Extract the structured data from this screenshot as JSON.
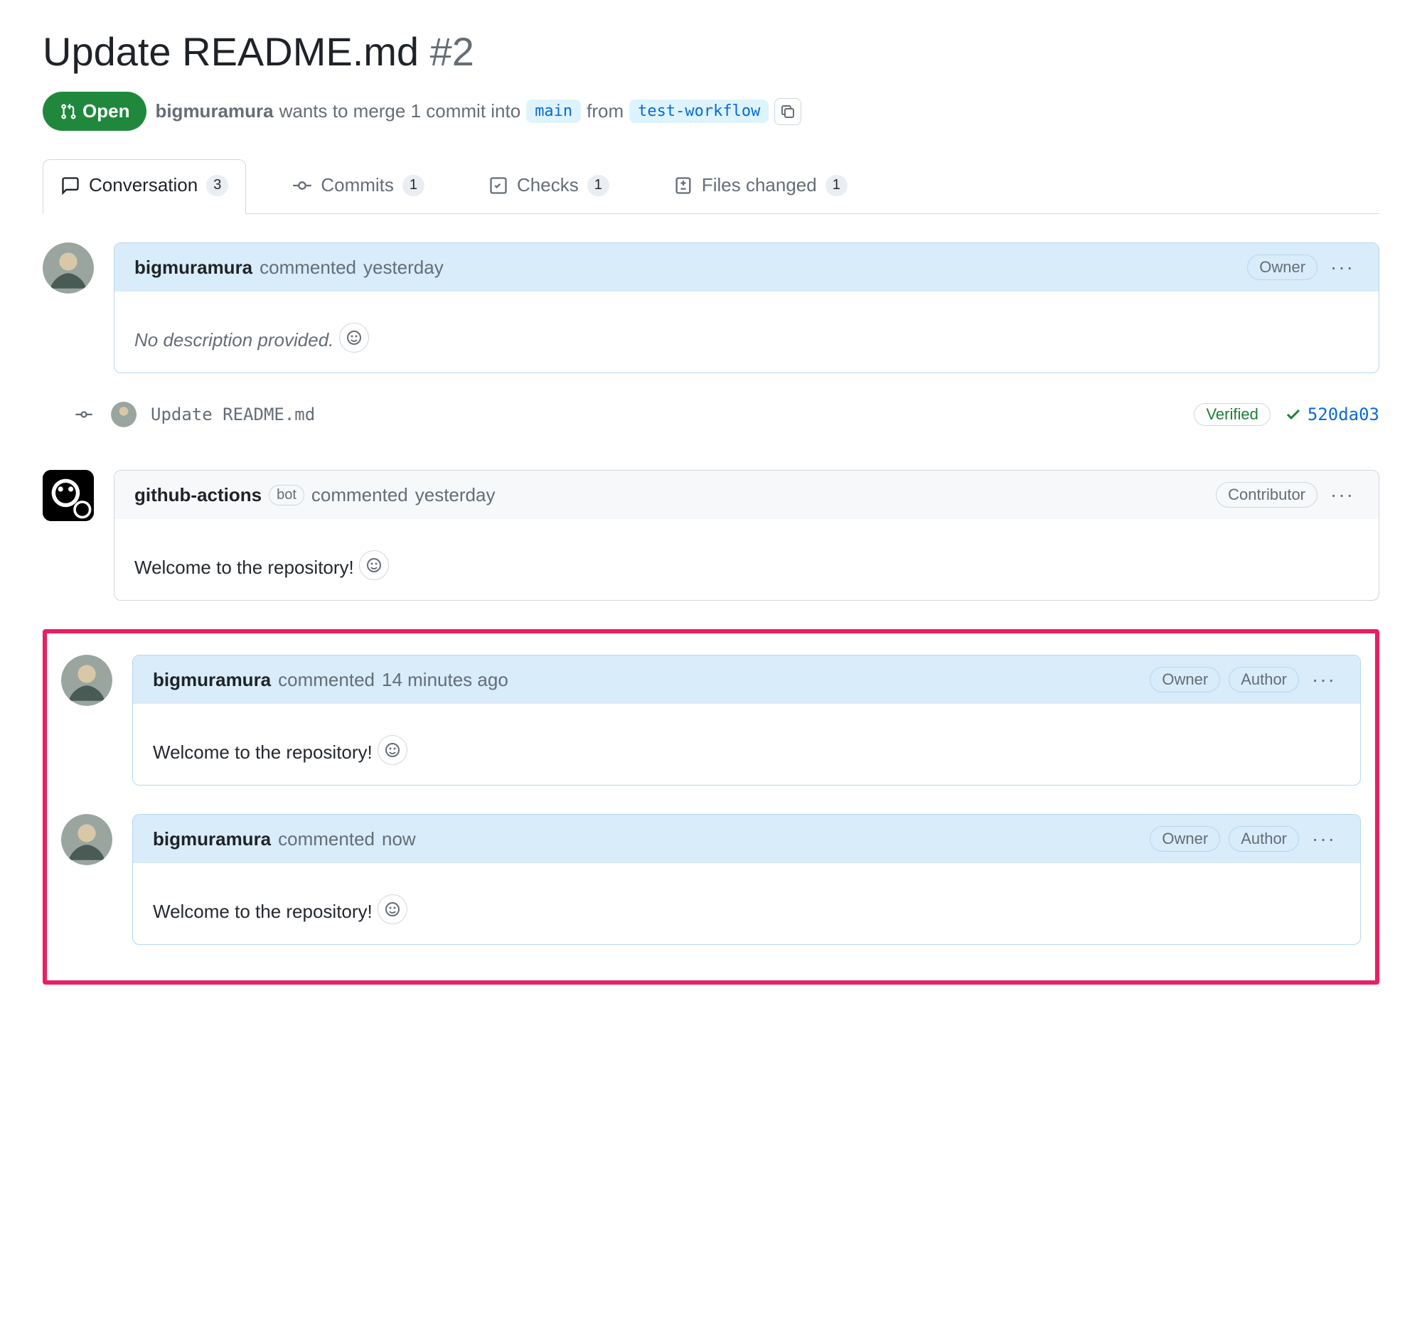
{
  "header": {
    "title": "Update README.md",
    "pr_number": "#2",
    "status": "Open",
    "author": "bigmuramura",
    "merge_text_1": "wants to merge 1 commit into",
    "base_branch": "main",
    "merge_text_2": "from",
    "head_branch": "test-workflow"
  },
  "tabs": [
    {
      "label": "Conversation",
      "count": "3",
      "icon": "comment"
    },
    {
      "label": "Commits",
      "count": "1",
      "icon": "commit"
    },
    {
      "label": "Checks",
      "count": "1",
      "icon": "check"
    },
    {
      "label": "Files changed",
      "count": "1",
      "icon": "diff"
    }
  ],
  "comments": [
    {
      "author": "bigmuramura",
      "action": "commented",
      "time": "yesterday",
      "body_placeholder": "No description provided.",
      "pills": [
        "Owner"
      ],
      "variant": "blue",
      "avatar": "user"
    },
    {
      "author": "github-actions",
      "bot": "bot",
      "action": "commented",
      "time": "yesterday",
      "body": "Welcome to the repository!",
      "pills": [
        "Contributor"
      ],
      "variant": "gray",
      "avatar": "bot"
    },
    {
      "author": "bigmuramura",
      "action": "commented",
      "time": "14 minutes ago",
      "body": "Welcome to the repository!",
      "pills": [
        "Owner",
        "Author"
      ],
      "variant": "blue",
      "avatar": "user"
    },
    {
      "author": "bigmuramura",
      "action": "commented",
      "time": "now",
      "body": "Welcome to the repository!",
      "pills": [
        "Owner",
        "Author"
      ],
      "variant": "blue",
      "avatar": "user"
    }
  ],
  "commit": {
    "message": "Update README.md",
    "verified": "Verified",
    "sha": "520da03"
  },
  "kebab": "···"
}
